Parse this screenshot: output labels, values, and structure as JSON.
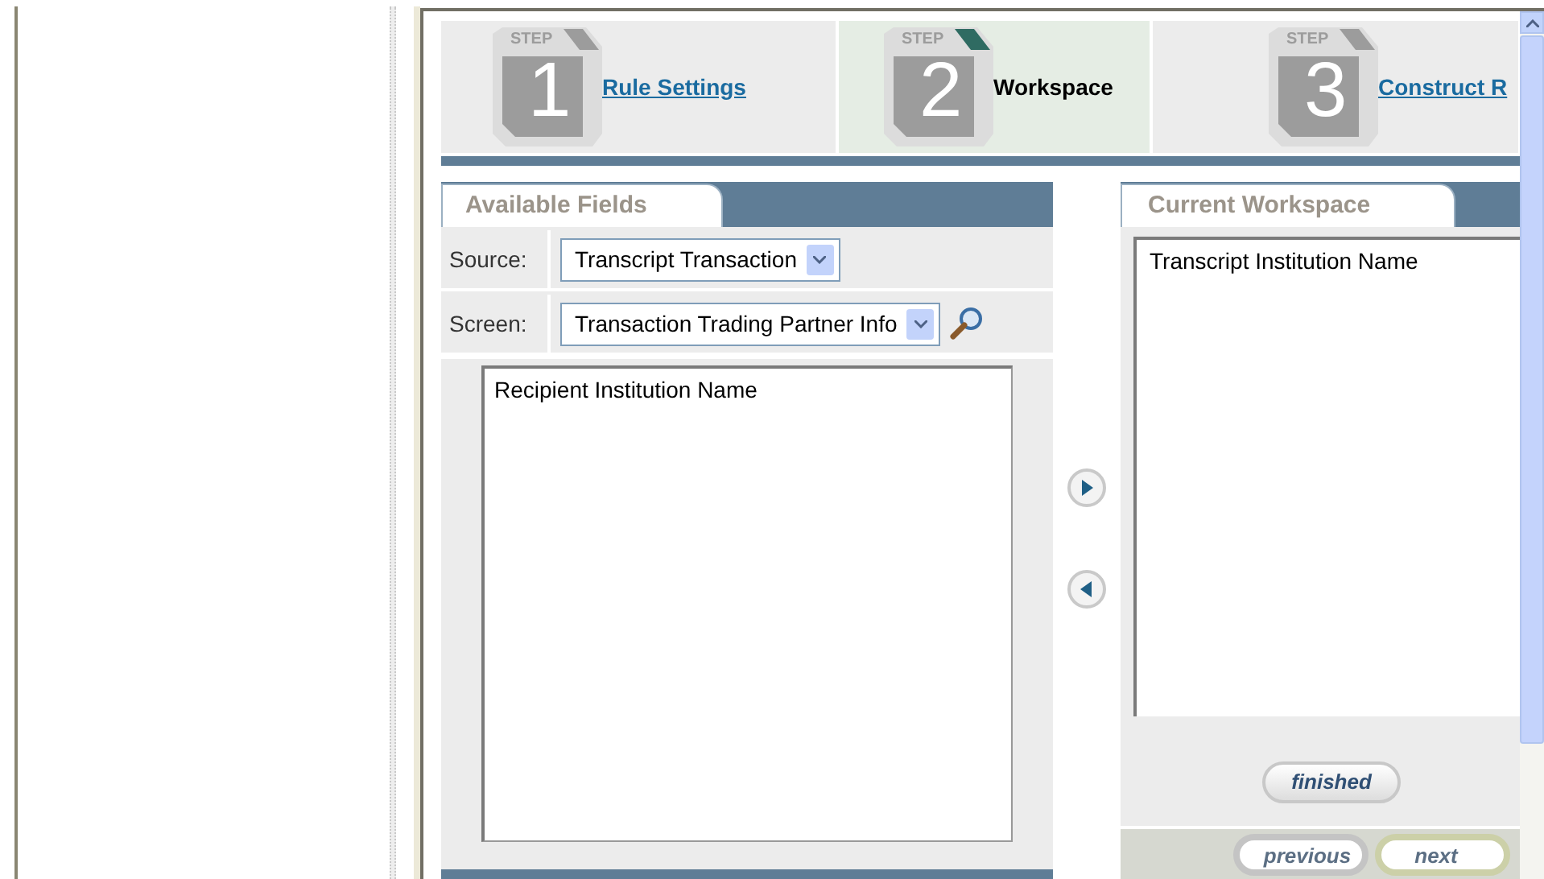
{
  "steps": [
    {
      "step_label": "STEP",
      "number": "1",
      "label": "Rule Settings",
      "selected": false
    },
    {
      "step_label": "STEP",
      "number": "2",
      "label": "Workspace",
      "selected": true
    },
    {
      "step_label": "STEP",
      "number": "3",
      "label": "Construct R",
      "selected": false
    }
  ],
  "available_fields": {
    "title": "Available Fields",
    "filters": [
      {
        "label": "Source:",
        "value": "Transcript Transaction",
        "search": false
      },
      {
        "label": "Screen:",
        "value": "Transaction Trading Partner Info",
        "search": true
      }
    ],
    "items": [
      "Recipient Institution Name"
    ]
  },
  "current_workspace": {
    "title": "Current Workspace",
    "items": [
      "Transcript Institution Name"
    ]
  },
  "buttons": {
    "finished": "finished",
    "previous": "previous",
    "next": "next"
  }
}
